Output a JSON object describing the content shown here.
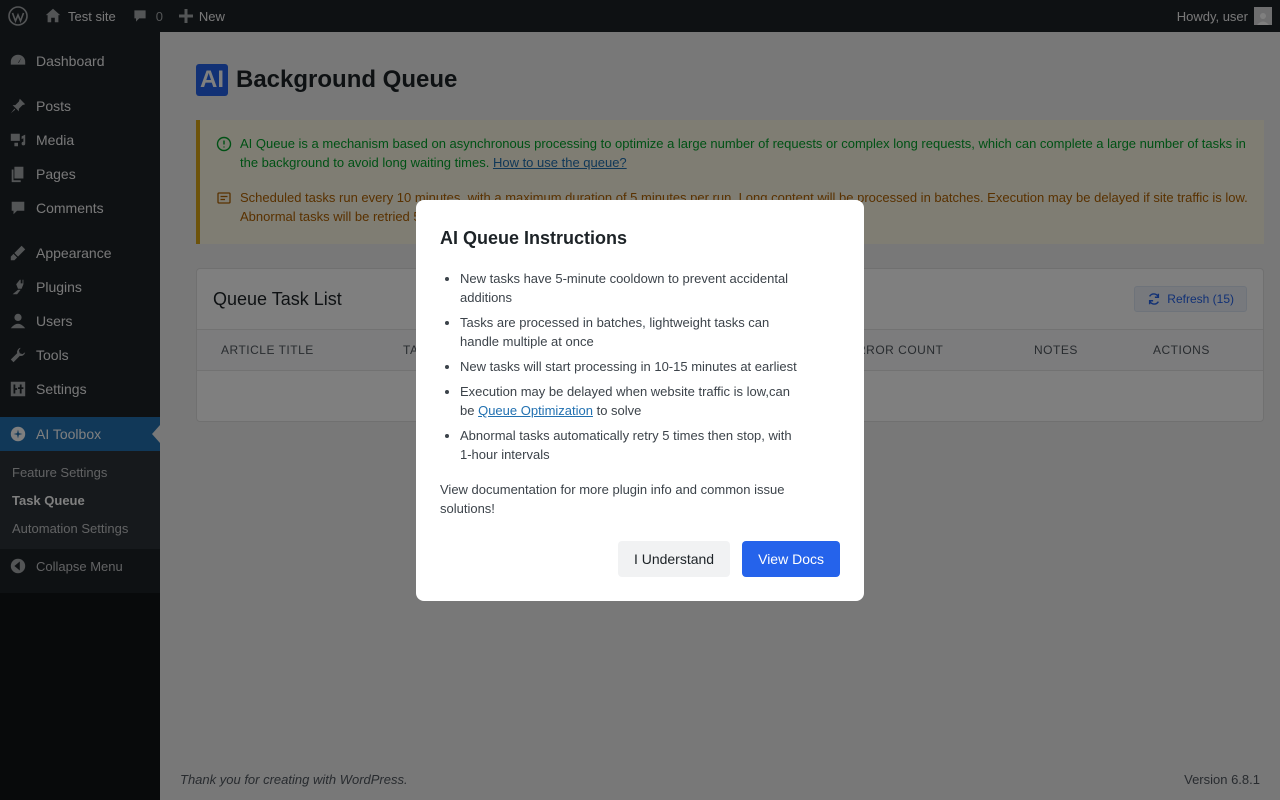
{
  "adminbar": {
    "site_name": "Test site",
    "comments_count": "0",
    "new_label": "New",
    "howdy": "Howdy, user"
  },
  "sidebar": {
    "items": [
      {
        "label": "Dashboard",
        "icon": "dashboard-icon"
      },
      {
        "label": "Posts",
        "icon": "pin-icon"
      },
      {
        "label": "Media",
        "icon": "media-icon"
      },
      {
        "label": "Pages",
        "icon": "pages-icon"
      },
      {
        "label": "Comments",
        "icon": "comment-icon"
      },
      {
        "label": "Appearance",
        "icon": "brush-icon"
      },
      {
        "label": "Plugins",
        "icon": "plug-icon"
      },
      {
        "label": "Users",
        "icon": "user-icon"
      },
      {
        "label": "Tools",
        "icon": "wrench-icon"
      },
      {
        "label": "Settings",
        "icon": "settings-icon"
      },
      {
        "label": "AI Toolbox",
        "icon": "ai-toolbox-icon"
      }
    ],
    "submenu": [
      "Feature Settings",
      "Task Queue",
      "Automation Settings"
    ],
    "collapse_label": "Collapse Menu"
  },
  "page": {
    "badge": "AI",
    "title": "Background Queue"
  },
  "notice": {
    "info_text": "AI Queue is a mechanism based on asynchronous processing to optimize a large number of requests or complex long requests, which can complete a large number of tasks in the background to avoid long waiting times.",
    "info_link": "How to use the queue?",
    "warn_text": "Scheduled tasks run every 10 minutes, with a maximum duration of 5 minutes per run. Long content will be processed in batches. Execution may be delayed if site traffic is low. Abnormal tasks will be retried 5 times."
  },
  "card": {
    "title": "Queue Task List",
    "refresh_label": "Refresh (15)",
    "columns": [
      "ARTICLE TITLE",
      "TA",
      "RROR COUNT",
      "NOTES",
      "ACTIONS"
    ]
  },
  "footer": {
    "left": "Thank you for creating with WordPress.",
    "right": "Version 6.8.1"
  },
  "modal": {
    "title": "AI Queue Instructions",
    "items": [
      "New tasks have 5-minute cooldown to prevent accidental additions",
      "Tasks are processed in batches, lightweight tasks can handle multiple at once",
      "New tasks will start processing in 10-15 minutes at earliest"
    ],
    "item4_prefix": "Execution may be delayed when website traffic is low,can be ",
    "item4_link": "Queue Optimization",
    "item4_suffix": " to solve",
    "item5": "Abnormal tasks automatically retry 5 times then stop, with 1-hour intervals",
    "note": "View documentation for more plugin info and common issue solutions!",
    "understand_label": "I Understand",
    "docs_label": "View Docs"
  },
  "colors": {
    "primary": "#2563eb",
    "wp_blue": "#2271b1",
    "admin_dark": "#1d2327",
    "notice_border": "#dba617"
  }
}
